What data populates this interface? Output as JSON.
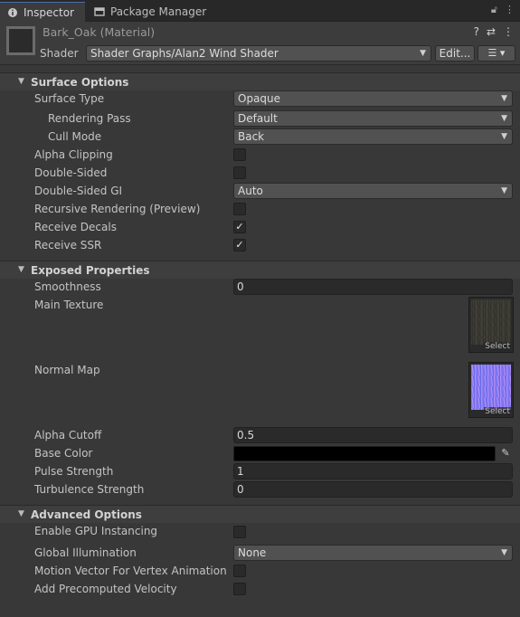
{
  "tabs": [
    {
      "label": "Inspector",
      "icon": "info-icon"
    },
    {
      "label": "Package Manager",
      "icon": "package-icon"
    }
  ],
  "material": {
    "title": "Bark_Oak (Material)",
    "shader_label": "Shader",
    "shader_value": "Shader Graphs/Alan2 Wind Shader",
    "edit_label": "Edit...",
    "list_label": "☰ ▾"
  },
  "surface_options": {
    "title": "Surface Options",
    "surface_type_label": "Surface Type",
    "surface_type_value": "Opaque",
    "rendering_pass_label": "Rendering Pass",
    "rendering_pass_value": "Default",
    "cull_mode_label": "Cull Mode",
    "cull_mode_value": "Back",
    "alpha_clipping_label": "Alpha Clipping",
    "alpha_clipping_checked": false,
    "double_sided_label": "Double-Sided",
    "double_sided_checked": false,
    "double_sided_gi_label": "Double-Sided GI",
    "double_sided_gi_value": "Auto",
    "recursive_label": "Recursive Rendering (Preview)",
    "recursive_checked": false,
    "receive_decals_label": "Receive Decals",
    "receive_decals_checked": true,
    "receive_ssr_label": "Receive SSR",
    "receive_ssr_checked": true
  },
  "exposed": {
    "title": "Exposed Properties",
    "smoothness_label": "Smoothness",
    "smoothness_value": "0",
    "main_texture_label": "Main Texture",
    "normal_map_label": "Normal Map",
    "select_label": "Select",
    "alpha_cutoff_label": "Alpha Cutoff",
    "alpha_cutoff_value": "0.5",
    "base_color_label": "Base Color",
    "base_color_value": "#000000",
    "pulse_label": "Pulse Strength",
    "pulse_value": "1",
    "turbulence_label": "Turbulence Strength",
    "turbulence_value": "0"
  },
  "advanced": {
    "title": "Advanced Options",
    "gpu_instancing_label": "Enable GPU Instancing",
    "gpu_instancing_checked": false,
    "gi_label": "Global Illumination",
    "gi_value": "None",
    "motion_vector_label": "Motion Vector For Vertex Animation",
    "motion_vector_checked": false,
    "precomputed_label": "Add Precomputed Velocity",
    "precomputed_checked": false
  },
  "colors": {
    "background": "#383838",
    "accent": "#4a6fa8"
  }
}
